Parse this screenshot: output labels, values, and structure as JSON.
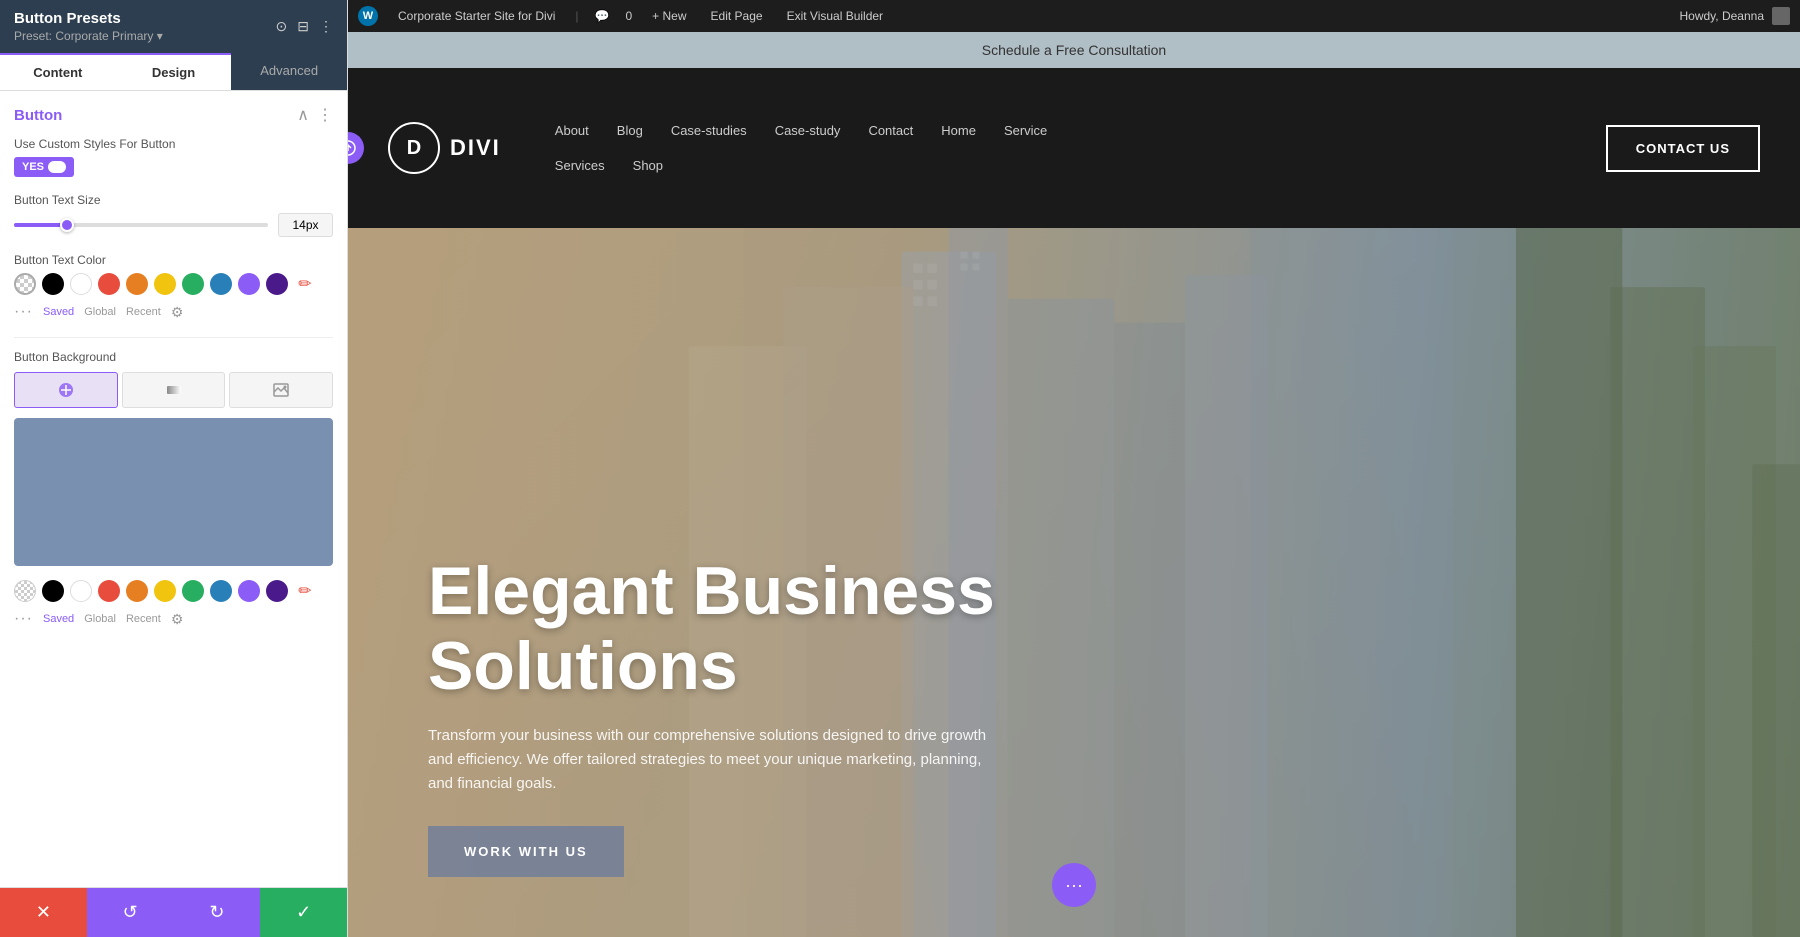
{
  "leftPanel": {
    "title": "Button Presets",
    "subtitle": "Preset: Corporate Primary ▾",
    "tabs": [
      "Content",
      "Design",
      "Advanced"
    ],
    "activeTab": "Design",
    "section": {
      "title": "Button",
      "customStylesLabel": "Use Custom Styles For Button",
      "toggleValue": "YES",
      "textSizeLabel": "Button Text Size",
      "textSizeValue": "14px",
      "textColorLabel": "Button Text Color",
      "colors": [
        {
          "id": "transparent",
          "hex": "transparent",
          "label": "transparent"
        },
        {
          "id": "black",
          "hex": "#000000",
          "label": "black"
        },
        {
          "id": "white",
          "hex": "#ffffff",
          "label": "white"
        },
        {
          "id": "red",
          "hex": "#e74c3c",
          "label": "red"
        },
        {
          "id": "orange",
          "hex": "#e67e22",
          "label": "orange"
        },
        {
          "id": "yellow",
          "hex": "#f1c40f",
          "label": "yellow"
        },
        {
          "id": "green",
          "hex": "#27ae60",
          "label": "green"
        },
        {
          "id": "blue",
          "hex": "#2980b9",
          "label": "blue"
        },
        {
          "id": "purple",
          "hex": "#8b5cf6",
          "label": "purple"
        },
        {
          "id": "darkpurple",
          "hex": "#4a1a8a",
          "label": "dark-purple"
        },
        {
          "id": "pencil",
          "hex": "pencil",
          "label": "pencil"
        }
      ],
      "colorMeta": {
        "saved": "Saved",
        "global": "Global",
        "recent": "Recent"
      },
      "bgLabel": "Button Background",
      "bgTypes": [
        "color",
        "gradient",
        "image"
      ],
      "bgColors": [
        {
          "id": "transparent",
          "hex": "transparent",
          "label": "transparent"
        },
        {
          "id": "black",
          "hex": "#000000",
          "label": "black"
        },
        {
          "id": "white",
          "hex": "#ffffff",
          "label": "white"
        },
        {
          "id": "red",
          "hex": "#e74c3c",
          "label": "red"
        },
        {
          "id": "orange",
          "hex": "#e67e22",
          "label": "orange"
        },
        {
          "id": "yellow",
          "hex": "#f1c40f",
          "label": "yellow"
        },
        {
          "id": "green",
          "hex": "#27ae60",
          "label": "green"
        },
        {
          "id": "blue",
          "hex": "#2980b9",
          "label": "blue"
        },
        {
          "id": "purple",
          "hex": "#8b5cf6",
          "label": "purple"
        },
        {
          "id": "darkpurple",
          "hex": "#4a1a8a",
          "label": "dark-purple"
        },
        {
          "id": "pencil2",
          "hex": "pencil",
          "label": "pencil"
        }
      ]
    },
    "footer": {
      "cancel": "✕",
      "undo": "↺",
      "redo": "↻",
      "save": "✓"
    }
  },
  "wpAdminBar": {
    "siteName": "Corporate Starter Site for Divi",
    "commentCount": "0",
    "newLabel": "+ New",
    "editPage": "Edit Page",
    "exitBuilder": "Exit Visual Builder",
    "howdy": "Howdy, Deanna"
  },
  "site": {
    "announcementBar": "Schedule a Free Consultation",
    "logo": {
      "icon": "D",
      "name": "DIVI"
    },
    "nav": {
      "row1": [
        "About",
        "Blog",
        "Case-studies",
        "Case-study",
        "Contact",
        "Home",
        "Service"
      ],
      "row2": [
        "Services",
        "Shop"
      ]
    },
    "contactBtn": "CONTACT US",
    "hero": {
      "title": "Elegant Business Solutions",
      "subtitle": "Transform your business with our comprehensive solutions designed to drive growth and efficiency. We offer tailored strategies to meet your unique marketing, planning, and financial goals.",
      "ctaLabel": "WORK WITH US"
    }
  }
}
